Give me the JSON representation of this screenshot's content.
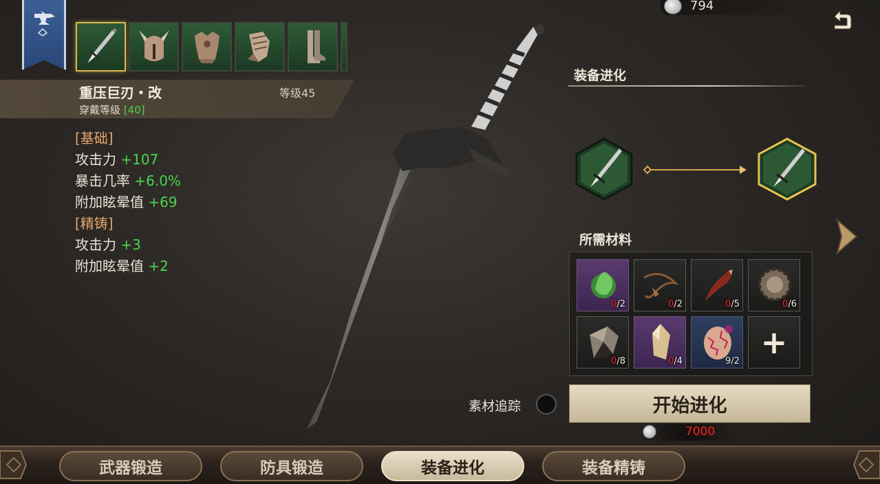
{
  "currency": {
    "amount": "794",
    "icon": "silver-coin-icon"
  },
  "equipment_slots": [
    {
      "name": "greatsword",
      "icon": "sword-icon",
      "selected": true
    },
    {
      "name": "helmet",
      "icon": "helmet-icon",
      "selected": false
    },
    {
      "name": "chest-armor",
      "icon": "chest-armor-icon",
      "selected": false
    },
    {
      "name": "gauntlet",
      "icon": "gauntlet-icon",
      "selected": false
    },
    {
      "name": "boots",
      "icon": "boots-icon",
      "selected": false
    }
  ],
  "item": {
    "name": "重压巨刃・改",
    "level_label": "等级45",
    "wear_label": "穿戴等级",
    "wear_value": "[40]"
  },
  "stats": {
    "base_title": "[基础]",
    "base": [
      {
        "label": "攻击力",
        "value": "+107"
      },
      {
        "label": "暴击几率",
        "value": "+6.0%"
      },
      {
        "label": "附加眩晕值",
        "value": "+69"
      }
    ],
    "refine_title": "[精铸]",
    "refine": [
      {
        "label": "攻击力",
        "value": "+3"
      },
      {
        "label": "附加眩晕值",
        "value": "+2"
      }
    ]
  },
  "panel": {
    "title": "装备进化",
    "materials_title": "所需材料",
    "materials": [
      {
        "icon": "green-essence-icon",
        "have": "0",
        "need": "2",
        "rarity": "purple"
      },
      {
        "icon": "leather-cord-icon",
        "have": "0",
        "need": "2",
        "rarity": "normal"
      },
      {
        "icon": "claw-fang-icon",
        "have": "0",
        "need": "5",
        "rarity": "normal"
      },
      {
        "icon": "gear-plate-icon",
        "have": "0",
        "need": "6",
        "rarity": "normal"
      },
      {
        "icon": "stone-slab-icon",
        "have": "0",
        "need": "8",
        "rarity": "normal"
      },
      {
        "icon": "crystal-shard-icon",
        "have": "0",
        "need": "4",
        "rarity": "purple"
      },
      {
        "icon": "cracked-egg-icon",
        "have": "9",
        "need": "2",
        "rarity": "blue"
      }
    ],
    "add_label": "+",
    "track_label": "素材追踪",
    "start_label": "开始进化",
    "cost": "7000",
    "cost_icon": "silver-coin-icon"
  },
  "tabs": [
    {
      "label": "武器锻造",
      "active": false
    },
    {
      "label": "防具锻造",
      "active": false
    },
    {
      "label": "装备进化",
      "active": true
    },
    {
      "label": "装备精铸",
      "active": false
    }
  ],
  "colors": {
    "stat_green": "#4cd44c",
    "section_orange": "#e4a56b",
    "insufficient_red": "#ff2a2a",
    "selected_gold": "#d8b84a"
  }
}
